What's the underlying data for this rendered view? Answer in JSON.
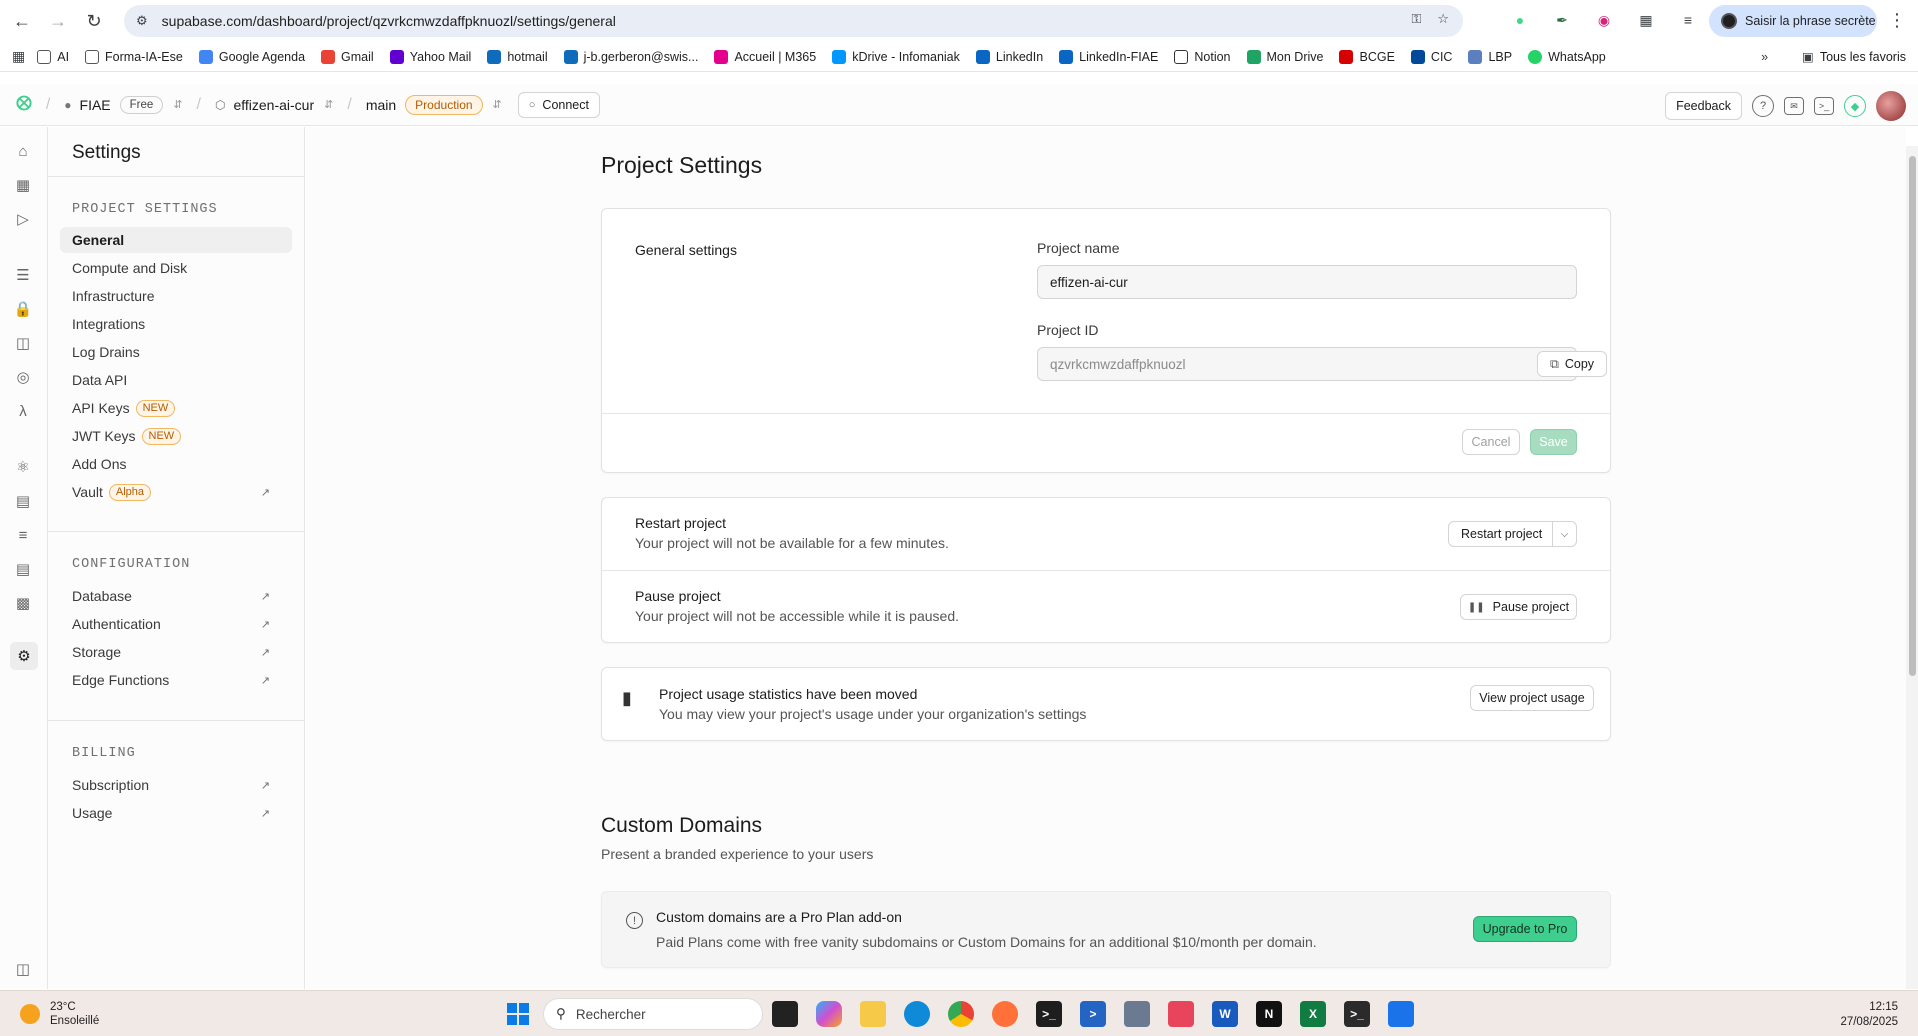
{
  "browser": {
    "url": "supabase.com/dashboard/project/qzvrkcmwzdaffpknuozl/settings/general",
    "profile_label": "Saisir la phrase secrète",
    "bookmarks": [
      "AI",
      "Forma-IA-Ese",
      "Google Agenda",
      "Gmail",
      "Yahoo Mail",
      "hotmail",
      "j-b.gerberon@swis...",
      "Accueil | M365",
      "kDrive - Infomaniak",
      "LinkedIn",
      "LinkedIn-FIAE",
      "Notion",
      "Mon Drive",
      "BCGE",
      "CIC",
      "LBP",
      "WhatsApp"
    ],
    "all_bookmarks_label": "Tous les favoris"
  },
  "topbar": {
    "org_name": "FIAE",
    "org_plan": "Free",
    "project_name": "effizen-ai-cur",
    "branch": "main",
    "env_badge": "Production",
    "connect_label": "Connect",
    "feedback_label": "Feedback"
  },
  "sidebar": {
    "title": "Settings",
    "sections": {
      "project": {
        "label": "PROJECT SETTINGS",
        "items": [
          "General",
          "Compute and Disk",
          "Infrastructure",
          "Integrations",
          "Log Drains",
          "Data API",
          "API Keys",
          "JWT Keys",
          "Add Ons",
          "Vault"
        ]
      },
      "configuration": {
        "label": "CONFIGURATION",
        "items": [
          "Database",
          "Authentication",
          "Storage",
          "Edge Functions"
        ]
      },
      "billing": {
        "label": "BILLING",
        "items": [
          "Subscription",
          "Usage"
        ]
      }
    },
    "tags": {
      "new": "NEW",
      "alpha": "Alpha"
    }
  },
  "main": {
    "page_title": "Project Settings",
    "general": {
      "section_label": "General settings",
      "project_name_label": "Project name",
      "project_name_value": "effizen-ai-cur",
      "project_id_label": "Project ID",
      "project_id_value": "qzvrkcmwzdaffpknuozl",
      "copy_label": "Copy",
      "cancel_label": "Cancel",
      "save_label": "Save"
    },
    "restart": {
      "title": "Restart project",
      "desc": "Your project will not be available for a few minutes.",
      "button": "Restart project"
    },
    "pause": {
      "title": "Pause project",
      "desc": "Your project will not be accessible while it is paused.",
      "button": "Pause project"
    },
    "usage": {
      "title": "Project usage statistics have been moved",
      "desc": "You may view your project's usage under your organization's settings",
      "button": "View project usage"
    },
    "custom_domains": {
      "title": "Custom Domains",
      "subtitle": "Present a branded experience to your users",
      "notice_title": "Custom domains are a Pro Plan add-on",
      "notice_desc": "Paid Plans come with free vanity subdomains or Custom Domains for an additional $10/month per domain.",
      "upgrade_label": "Upgrade to Pro"
    }
  },
  "taskbar": {
    "temp": "23°C",
    "weather": "Ensoleillé",
    "search_placeholder": "Rechercher",
    "time": "12:15",
    "date": "27/08/2025"
  },
  "colors": {
    "brand_green": "#3ecf8e",
    "production_orange": "#b45c00"
  }
}
